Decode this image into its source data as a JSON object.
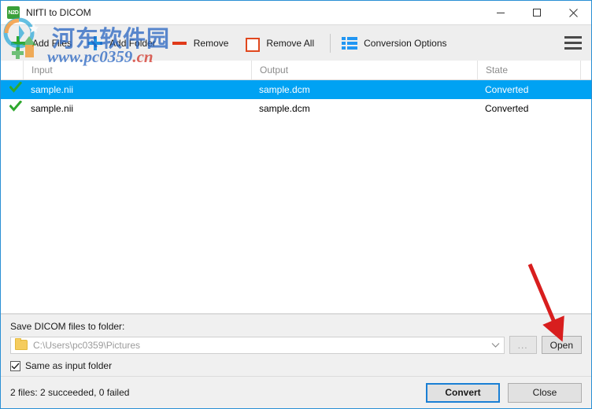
{
  "window": {
    "title": "NIfTI to DICOM",
    "app_icon": "n2d-app-icon",
    "icon_text": "N2D",
    "minimize": "minimize-icon",
    "maximize": "maximize-icon",
    "close": "close-icon",
    "border_color": "#2a8fd4"
  },
  "toolbar": {
    "add_files": "Add Files",
    "add_folder": "Add Folder",
    "remove": "Remove",
    "remove_all": "Remove All",
    "conversion_options": "Conversion Options",
    "menu_icon": "hamburger-menu-icon"
  },
  "list": {
    "columns": [
      "Input",
      "Output",
      "State"
    ],
    "rows": [
      {
        "status_icon": "green-check-icon",
        "input": "sample.nii",
        "output": "sample.dcm",
        "state": "Converted",
        "selected": true
      },
      {
        "status_icon": "green-check-icon",
        "input": "sample.nii",
        "output": "sample.dcm",
        "state": "Converted",
        "selected": false
      }
    ],
    "selection_color": "#00a2f3",
    "check_color": "#2fa82f"
  },
  "destination": {
    "label": "Save DICOM files to folder:",
    "path_value": "C:\\Users\\pc0359\\Pictures",
    "path_placeholder": "C:\\Users\\pc0359\\Pictures",
    "browse_label": "...",
    "open_label": "Open",
    "same_as_input_label": "Same as input folder",
    "same_as_input_checked": true,
    "folder_icon": "folder-icon",
    "dropdown_icon": "chevron-down-icon"
  },
  "status": {
    "text": "2 files: 2 succeeded, 0 failed",
    "convert_label": "Convert",
    "close_label": "Close"
  },
  "watermark": {
    "chinese": "河东软件园",
    "url_prefix": "www.pc0359",
    "url_suffix": ".cn",
    "logo_icon": "site-logo-icon",
    "color_blue": "#1f5fc0",
    "color_red": "#d02b1f"
  },
  "annotation": {
    "arrow_icon": "red-arrow-icon",
    "arrow_color": "#d81e1e"
  }
}
